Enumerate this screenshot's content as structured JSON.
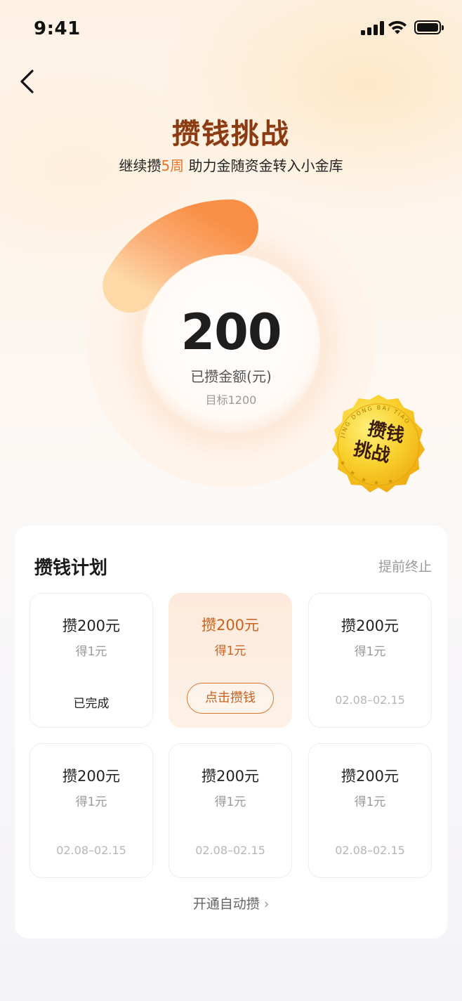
{
  "status_bar": {
    "time": "9:41"
  },
  "header": {
    "title": "攒钱挑战",
    "subtitle_prefix": "继续攒",
    "subtitle_highlight": "5周",
    "subtitle_suffix": "助力金随资金转入小金库"
  },
  "progress": {
    "amount": "200",
    "amount_label": "已攒金额(元)",
    "target_label": "目标1200",
    "saved_value": 200,
    "target_value": 1200,
    "fraction": 0.1667
  },
  "badge": {
    "line1": "攒钱",
    "line2": "挑战",
    "ring_text": "JING DONG BAI TIAO"
  },
  "plan": {
    "title": "攒钱计划",
    "terminate_label": "提前终止",
    "tiles": [
      {
        "amount": "攒200元",
        "reward": "得1元",
        "footer": "已完成",
        "state": "done"
      },
      {
        "amount": "攒200元",
        "reward": "得1元",
        "button": "点击攒钱",
        "state": "active"
      },
      {
        "amount": "攒200元",
        "reward": "得1元",
        "footer": "02.08–02.15",
        "state": "upcoming"
      },
      {
        "amount": "攒200元",
        "reward": "得1元",
        "footer": "02.08–02.15",
        "state": "upcoming"
      },
      {
        "amount": "攒200元",
        "reward": "得1元",
        "footer": "02.08–02.15",
        "state": "upcoming"
      },
      {
        "amount": "攒200元",
        "reward": "得1元",
        "footer": "02.08–02.15",
        "state": "upcoming"
      }
    ],
    "auto_save_label": "开通自动攒",
    "auto_save_icon": "chevron-right-icon"
  },
  "colors": {
    "accent": "#e8752a",
    "title_brown": "#8a3b13",
    "badge_gold": "#f6c21a"
  }
}
